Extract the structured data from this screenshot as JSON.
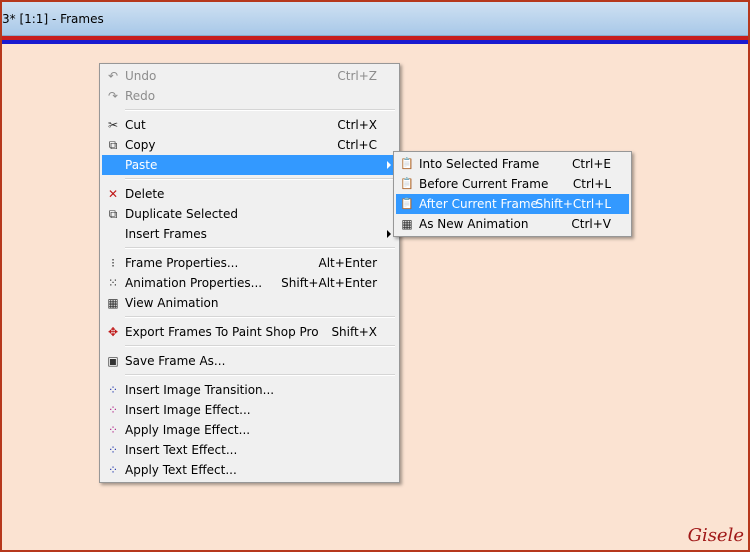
{
  "window": {
    "title": "3* [1:1] - Frames"
  },
  "context_menu": {
    "items": [
      {
        "label": "Undo",
        "shortcut": "Ctrl+Z",
        "icon": "undo-icon",
        "glyph": "↶",
        "disabled": true
      },
      {
        "label": "Redo",
        "shortcut": "",
        "icon": "redo-icon",
        "glyph": "↷",
        "disabled": true
      },
      {
        "label": "Cut",
        "shortcut": "Ctrl+X",
        "icon": "scissors-icon",
        "glyph": "✂"
      },
      {
        "label": "Copy",
        "shortcut": "Ctrl+C",
        "icon": "copy-icon",
        "glyph": "⧉"
      },
      {
        "label": "Paste",
        "shortcut": "",
        "icon": "",
        "glyph": "",
        "selected": true,
        "submenu": true
      },
      {
        "label": "Delete",
        "shortcut": "",
        "icon": "delete-icon",
        "glyph": "✕"
      },
      {
        "label": "Duplicate Selected",
        "shortcut": "",
        "icon": "duplicate-icon",
        "glyph": "⧉"
      },
      {
        "label": "Insert Frames",
        "shortcut": "",
        "icon": "",
        "glyph": "",
        "submenu": true
      },
      {
        "label": "Frame Properties...",
        "shortcut": "Alt+Enter",
        "icon": "frame-properties-icon",
        "glyph": "⁝"
      },
      {
        "label": "Animation Properties...",
        "shortcut": "Shift+Alt+Enter",
        "icon": "animation-properties-icon",
        "glyph": "⁙"
      },
      {
        "label": "View Animation",
        "shortcut": "",
        "icon": "film-strip-icon",
        "glyph": "▦"
      },
      {
        "label": "Export Frames To Paint Shop Pro",
        "shortcut": "Shift+X",
        "icon": "export-icon",
        "glyph": "✥"
      },
      {
        "label": "Save Frame As...",
        "shortcut": "",
        "icon": "save-frame-icon",
        "glyph": "▣"
      },
      {
        "label": "Insert Image Transition...",
        "shortcut": "",
        "icon": "image-transition-icon",
        "glyph": "⁘"
      },
      {
        "label": "Insert Image Effect...",
        "shortcut": "",
        "icon": "image-effect-icon",
        "glyph": "⁘"
      },
      {
        "label": "Apply Image Effect...",
        "shortcut": "",
        "icon": "apply-image-effect-icon",
        "glyph": "⁘"
      },
      {
        "label": "Insert Text Effect...",
        "shortcut": "",
        "icon": "text-effect-icon",
        "glyph": "⁘"
      },
      {
        "label": "Apply Text Effect...",
        "shortcut": "",
        "icon": "apply-text-effect-icon",
        "glyph": "⁘"
      }
    ]
  },
  "paste_submenu": {
    "items": [
      {
        "label": "Into Selected Frame",
        "shortcut": "Ctrl+E",
        "icon": "paste-into-icon",
        "glyph": "📋"
      },
      {
        "label": "Before Current Frame",
        "shortcut": "Ctrl+L",
        "icon": "paste-before-icon",
        "glyph": "📋"
      },
      {
        "label": "After Current Frame",
        "shortcut": "Shift+Ctrl+L",
        "icon": "paste-after-icon",
        "glyph": "📋",
        "selected": true
      },
      {
        "label": "As New Animation",
        "shortcut": "Ctrl+V",
        "icon": "paste-new-animation-icon",
        "glyph": "▦"
      }
    ]
  },
  "signature": "Gisele"
}
